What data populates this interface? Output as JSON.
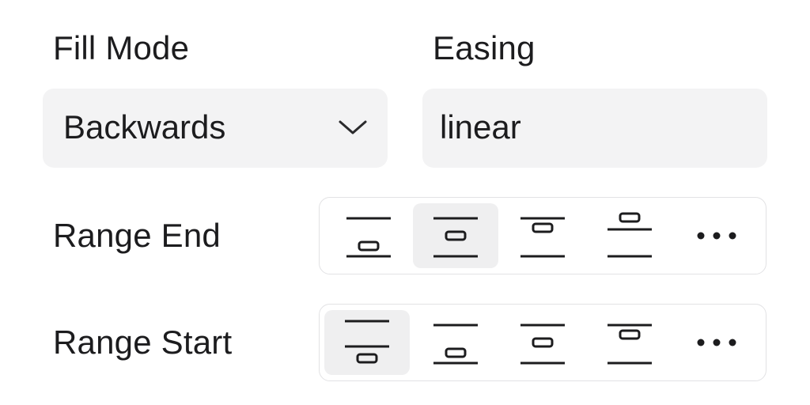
{
  "fill_mode": {
    "label": "Fill Mode",
    "value": "Backwards",
    "icon": "chevron-down-icon"
  },
  "easing": {
    "label": "Easing",
    "value": "linear"
  },
  "range_end": {
    "label": "Range End",
    "selected_index": 1,
    "options": [
      {
        "icon": "align-bottom-icon"
      },
      {
        "icon": "align-center-icon"
      },
      {
        "icon": "align-top-icon"
      },
      {
        "icon": "align-above-icon"
      },
      {
        "icon": "more-icon"
      }
    ]
  },
  "range_start": {
    "label": "Range Start",
    "selected_index": 0,
    "options": [
      {
        "icon": "align-below-icon"
      },
      {
        "icon": "align-bottom-icon"
      },
      {
        "icon": "align-center-icon"
      },
      {
        "icon": "align-top-icon"
      },
      {
        "icon": "more-icon"
      }
    ]
  }
}
